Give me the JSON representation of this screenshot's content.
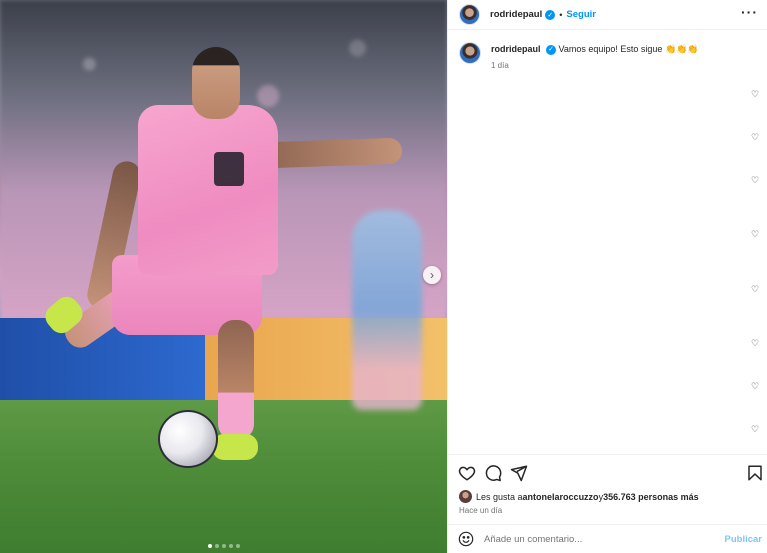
{
  "post": {
    "username": "rodridepaul",
    "follow_label": "Seguir",
    "separator": "•",
    "more_label": "···",
    "caption_username": "rodridepaul",
    "caption_text": "Vamos equipo! Esto sigue 👏👏👏",
    "caption_time": "1 día",
    "likes_prefix": "Les gusta a ",
    "likes_user": "antonelaroccuzzo",
    "likes_middle": " y ",
    "likes_count": "356.763 personas más",
    "posted_ago": "Hace un día",
    "comment_placeholder": "Añade un comentario...",
    "publish_label": "Publicar",
    "next_glyph": "›"
  },
  "media": {
    "carousel_total": 5,
    "carousel_active": 1
  },
  "colors": {
    "accent": "#0095f6",
    "publish_disabled": "#7fc6f8",
    "shirt_pink": "#f7a6cf"
  },
  "icons": [
    "verified-badge-icon",
    "more-options-icon",
    "like-heart-icon",
    "comment-icon",
    "share-icon",
    "save-bookmark-icon",
    "emoji-icon",
    "next-arrow-icon"
  ]
}
